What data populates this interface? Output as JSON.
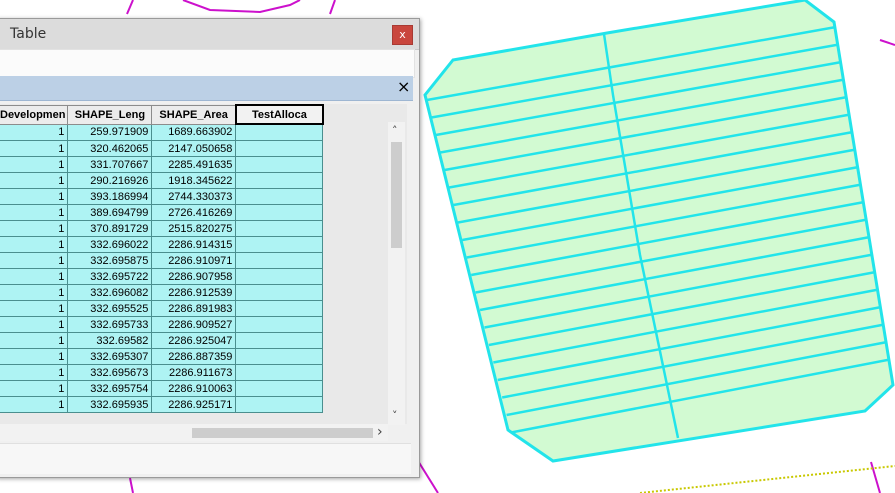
{
  "window": {
    "title": "Table",
    "close_label": "x",
    "tab_close_label": "×"
  },
  "grid": {
    "columns": [
      "Developmen",
      "SHAPE_Leng",
      "SHAPE_Area",
      "TestAlloca"
    ],
    "selected_column": "TestAlloca",
    "rows": [
      [
        "1",
        "259.971909",
        "1689.663902",
        ""
      ],
      [
        "1",
        "320.462065",
        "2147.050658",
        ""
      ],
      [
        "1",
        "331.707667",
        "2285.491635",
        ""
      ],
      [
        "1",
        "290.216926",
        "1918.345622",
        ""
      ],
      [
        "1",
        "393.186994",
        "2744.330373",
        ""
      ],
      [
        "1",
        "389.694799",
        "2726.416269",
        ""
      ],
      [
        "1",
        "370.891729",
        "2515.820275",
        ""
      ],
      [
        "1",
        "332.696022",
        "2286.914315",
        ""
      ],
      [
        "1",
        "332.695875",
        "2286.910971",
        ""
      ],
      [
        "1",
        "332.695722",
        "2286.907958",
        ""
      ],
      [
        "1",
        "332.696082",
        "2286.912539",
        ""
      ],
      [
        "1",
        "332.695525",
        "2286.891983",
        ""
      ],
      [
        "1",
        "332.695733",
        "2286.909527",
        ""
      ],
      [
        "1",
        "332.69582",
        "2286.925047",
        ""
      ],
      [
        "1",
        "332.695307",
        "2286.887359",
        ""
      ],
      [
        "1",
        "332.695673",
        "2286.911673",
        ""
      ],
      [
        "1",
        "332.695754",
        "2286.910063",
        ""
      ],
      [
        "1",
        "332.695935",
        "2286.925171",
        ""
      ]
    ]
  },
  "scroll": {
    "up_arrow": "˄",
    "down_arrow": "˅",
    "right_arrow": "›"
  },
  "map": {
    "parcel_fill": "#d2fad2",
    "parcel_stroke": "#22e4ea",
    "road_color": "#cc11cc",
    "road_alt_color": "#c8c800"
  }
}
